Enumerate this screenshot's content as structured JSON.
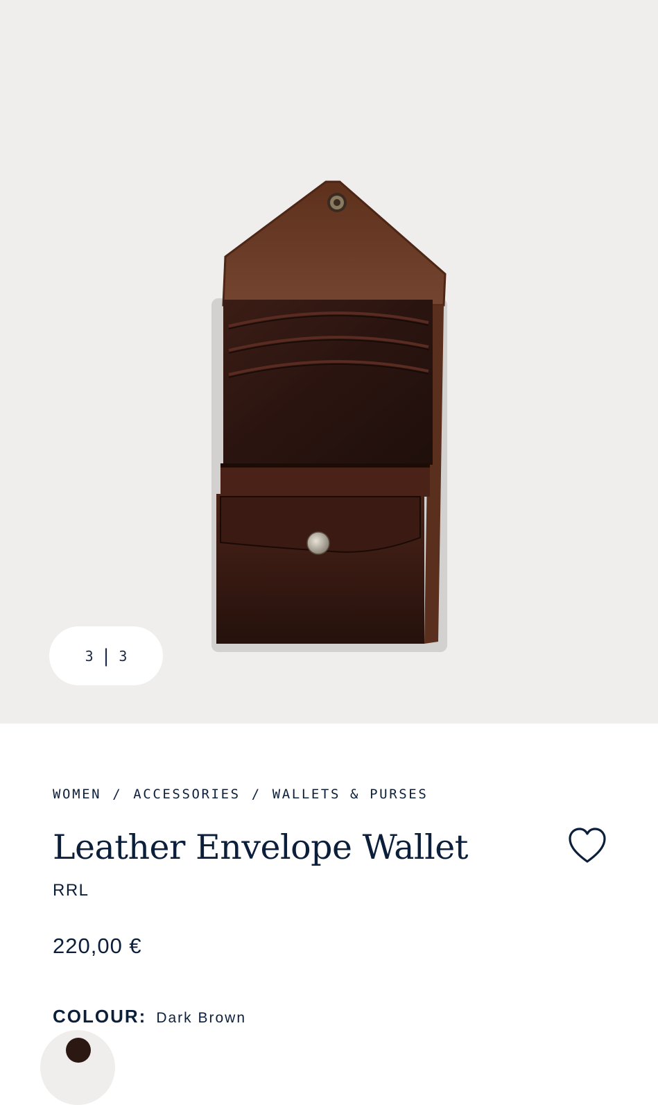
{
  "gallery": {
    "current": "3",
    "total": "3",
    "separator": "|",
    "image_subject": "wallet-image"
  },
  "breadcrumb": {
    "items": [
      "WOMEN",
      "ACCESSORIES",
      "WALLETS & PURSES"
    ],
    "separator": "/"
  },
  "product": {
    "title": "Leather Envelope Wallet",
    "brand": "RRL",
    "price": "220,00 €"
  },
  "colour": {
    "label": "COLOUR:",
    "value": "Dark Brown"
  },
  "icons": {
    "favorite": "heart-icon"
  },
  "colors": {
    "text": "#0c1f3a",
    "hero_bg": "#f0eeec",
    "leather_dark": "#2b1812",
    "leather_flap": "#6a3a24"
  }
}
